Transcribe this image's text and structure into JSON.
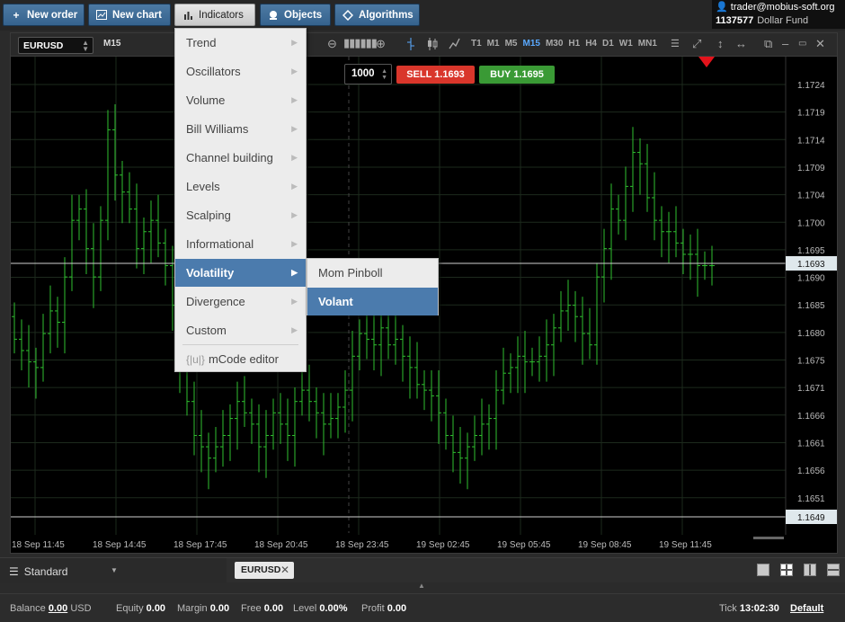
{
  "toolbar": {
    "new_order": "New order",
    "new_chart": "New chart",
    "indicators": "Indicators",
    "objects": "Objects",
    "algorithms": "Algorithms"
  },
  "account": {
    "user": "trader@mobius-soft.org",
    "number": "1137577",
    "fund": "Dollar Fund"
  },
  "chart": {
    "symbol": "EURUSD",
    "timeframe": "M15",
    "timeframes": [
      "T1",
      "M1",
      "M5",
      "M15",
      "M30",
      "H1",
      "H4",
      "D1",
      "W1",
      "MN1"
    ],
    "active_timeframe": "M15"
  },
  "order": {
    "quantity": "1000",
    "sell_label": "SELL 1.1693",
    "buy_label": "BUY 1.1695"
  },
  "menu": {
    "items": [
      {
        "label": "Trend"
      },
      {
        "label": "Oscillators"
      },
      {
        "label": "Volume"
      },
      {
        "label": "Bill Williams"
      },
      {
        "label": "Channel building"
      },
      {
        "label": "Levels"
      },
      {
        "label": "Scalping"
      },
      {
        "label": "Informational"
      },
      {
        "label": "Volatility"
      },
      {
        "label": "Divergence"
      },
      {
        "label": "Custom"
      }
    ],
    "selected": "Volatility",
    "mcode_editor": "mCode editor",
    "submenu": [
      {
        "label": "Mom Pinboll"
      },
      {
        "label": "Volant"
      }
    ],
    "submenu_selected": "Volant"
  },
  "price_axis": {
    "ticks": [
      "1.1724",
      "1.1719",
      "1.1714",
      "1.1709",
      "1.1704",
      "1.1700",
      "1.1695",
      "1.1690",
      "1.1685",
      "1.1680",
      "1.1675",
      "1.1671",
      "1.1666",
      "1.1661",
      "1.1656",
      "1.1651"
    ],
    "current_price": "1.1693",
    "low_line_price": "1.1649"
  },
  "time_axis": {
    "ticks": [
      "18 Sep 11:45",
      "18 Sep 14:45",
      "18 Sep 17:45",
      "18 Sep 20:45",
      "18 Sep 23:45",
      "19 Sep 02:45",
      "19 Sep 05:45",
      "19 Sep 08:45",
      "19 Sep 11:45"
    ]
  },
  "colors": {
    "bar": "#2fbf2f",
    "grid": "#1d2a1d",
    "sell": "#d9362b",
    "buy": "#3a9a35",
    "accent": "#4b7bad"
  },
  "workspace": {
    "name": "Standard",
    "tab": "EURUSD"
  },
  "status": {
    "balance_label": "Balance",
    "balance": "0.00",
    "currency": "USD",
    "equity_label": "Equity",
    "equity": "0.00",
    "margin_label": "Margin",
    "margin": "0.00",
    "free_label": "Free",
    "free": "0.00",
    "level_label": "Level",
    "level": "0.00%",
    "profit_label": "Profit",
    "profit": "0.00",
    "tick_label": "Tick",
    "tick_time": "13:02:30",
    "default_label": "Default"
  }
}
